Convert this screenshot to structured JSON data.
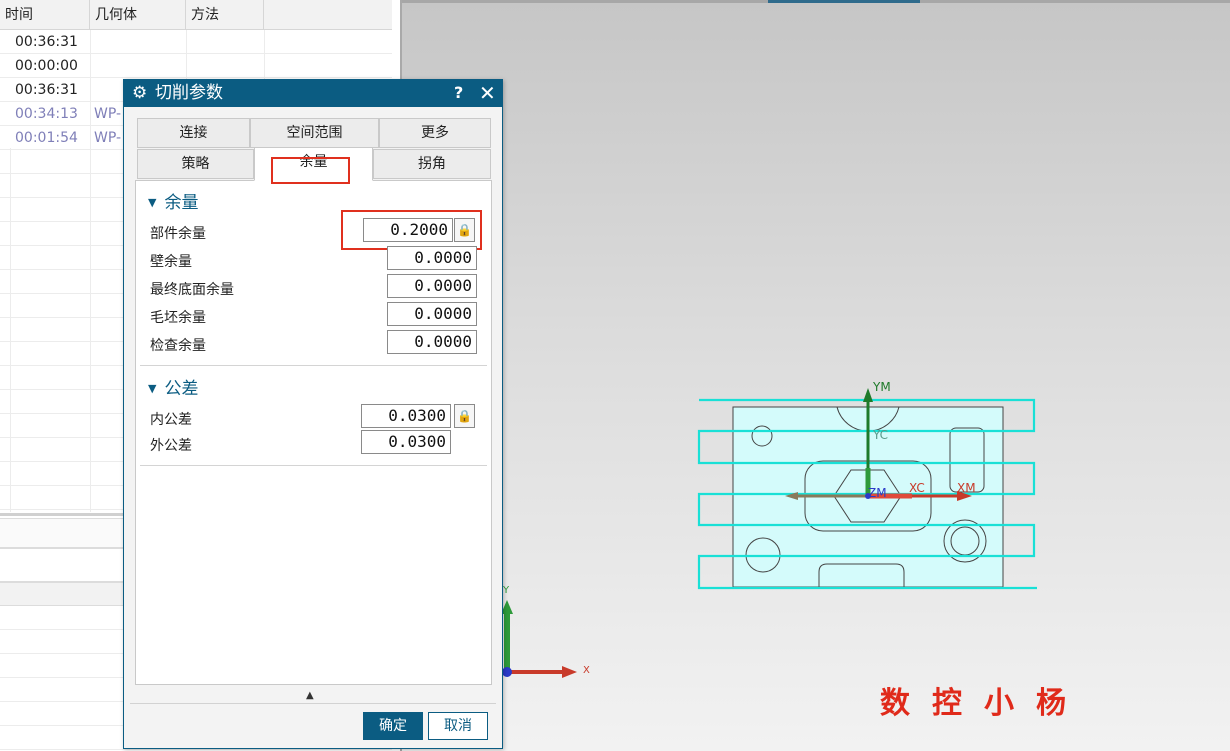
{
  "navigator": {
    "columns": [
      "时间",
      "几何体",
      "方法"
    ],
    "rows": [
      {
        "time": "00:36:31",
        "geometry": "",
        "dim": false
      },
      {
        "time": "00:00:00",
        "geometry": "",
        "dim": false
      },
      {
        "time": "00:36:31",
        "geometry": "",
        "dim": false
      },
      {
        "time": "00:34:13",
        "geometry": "WP-",
        "dim": true
      },
      {
        "time": "00:01:54",
        "geometry": "WP-",
        "dim": true
      }
    ]
  },
  "dialog": {
    "title": "切削参数",
    "help": "?",
    "close": "✕",
    "tabs_row1": [
      "连接",
      "空间范围",
      "更多"
    ],
    "tabs_row2": [
      "策略",
      "余量",
      "拐角"
    ],
    "active_tab": "余量",
    "stock_section": {
      "title": "余量",
      "fields": [
        {
          "label": "部件余量",
          "value": "0.2000",
          "locked": true
        },
        {
          "label": "壁余量",
          "value": "0.0000",
          "locked": false
        },
        {
          "label": "最终底面余量",
          "value": "0.0000",
          "locked": false
        },
        {
          "label": "毛坯余量",
          "value": "0.0000",
          "locked": false
        },
        {
          "label": "检查余量",
          "value": "0.0000",
          "locked": false
        }
      ]
    },
    "tolerance_section": {
      "title": "公差",
      "fields": [
        {
          "label": "内公差",
          "value": "0.0300",
          "locked": true
        },
        {
          "label": "外公差",
          "value": "0.0300",
          "locked": false
        }
      ]
    },
    "ok_label": "确定",
    "cancel_label": "取消"
  },
  "viewport": {
    "axis_labels": {
      "ym": "YM",
      "yc": "YC",
      "zm": "ZM",
      "xc": "XC",
      "xm": "XM",
      "triad_y": "Y",
      "triad_x": "X"
    }
  },
  "watermark": "数控小杨",
  "colors": {
    "accent": "#0b5c82",
    "highlight": "#e0301e",
    "toolpath": "#19e0d6",
    "part_fill": "#d4fbfb"
  }
}
